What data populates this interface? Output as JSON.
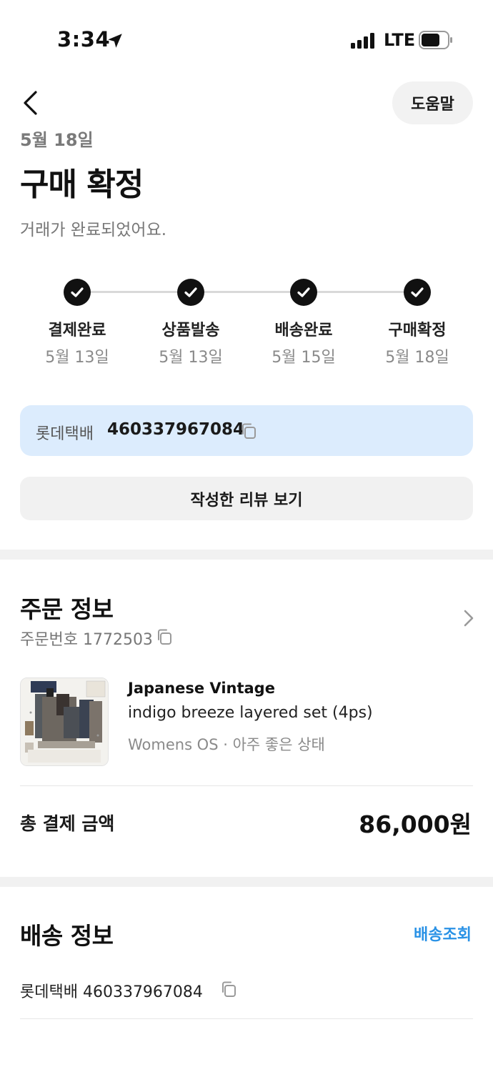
{
  "status_bar": {
    "time": "3:34",
    "network": "LTE"
  },
  "header": {
    "help_label": "도움말"
  },
  "summary": {
    "date": "5월 18일",
    "title": "구매 확정",
    "subtitle": "거래가 완료되었어요."
  },
  "steps": [
    {
      "label": "결제완료",
      "date": "5월 13일"
    },
    {
      "label": "상품발송",
      "date": "5월 13일"
    },
    {
      "label": "배송완료",
      "date": "5월 15일"
    },
    {
      "label": "구매확정",
      "date": "5월 18일"
    }
  ],
  "tracking": {
    "carrier": "롯데택배",
    "number": "460337967084"
  },
  "review_button_label": "작성한 리뷰 보기",
  "order": {
    "title": "주문 정보",
    "order_number": "주문번호 1772503",
    "product": {
      "brand": "Japanese Vintage",
      "name": "indigo breeze layered set (4ps)",
      "meta": "Womens OS · 아주 좋은 상태"
    },
    "total_label": "총 결제 금액",
    "total_value": "86,000원"
  },
  "shipping": {
    "title": "배송 정보",
    "track_label": "배송조회",
    "line": "롯데택배 460337967084"
  },
  "colors": {
    "accent_blue": "#2a92e6",
    "tracking_bg": "#dcecfd",
    "check_bg": "#111111"
  }
}
